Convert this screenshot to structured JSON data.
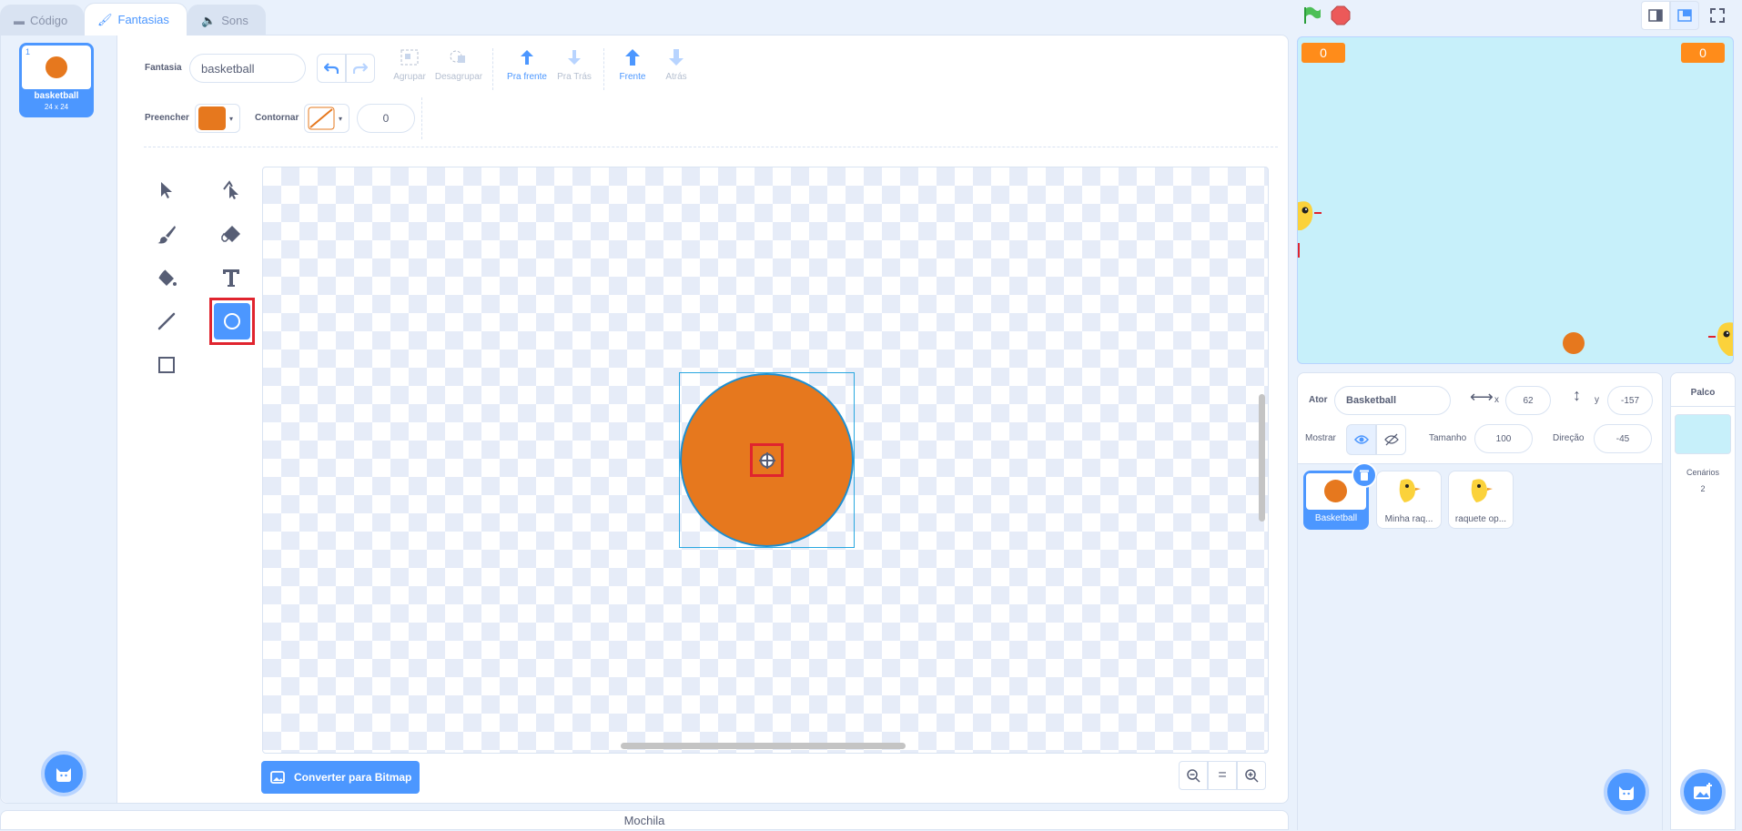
{
  "tabs": {
    "code": "Código",
    "costumes": "Fantasias",
    "sounds": "Sons"
  },
  "costume_list": [
    {
      "number": "1",
      "name": "basketball",
      "size": "24 x 24"
    }
  ],
  "toolbar": {
    "costume_label": "Fantasia",
    "costume_name": "basketball",
    "group": "Agrupar",
    "ungroup": "Desagrupar",
    "forward": "Pra frente",
    "backward": "Pra Trás",
    "front": "Frente",
    "back": "Atrás",
    "fill_label": "Preencher",
    "outline_label": "Contornar",
    "outline_width": "0",
    "fill_color": "#e6781e"
  },
  "tools": {
    "active": "circle-tool"
  },
  "bottom": {
    "convert": "Converter para Bitmap",
    "zoom_reset": "="
  },
  "backpack": "Mochila",
  "stage": {
    "monitor_left": "0",
    "monitor_right": "0",
    "background": "#c7f0fa"
  },
  "sprite_info": {
    "sprite_label": "Ator",
    "sprite_name": "Basketball",
    "x_label": "x",
    "x_value": "62",
    "y_label": "y",
    "y_value": "-157",
    "show_label": "Mostrar",
    "size_label": "Tamanho",
    "size_value": "100",
    "direction_label": "Direção",
    "direction_value": "-45"
  },
  "sprites": [
    {
      "name": "Basketball",
      "selected": true
    },
    {
      "name": "Minha raq..."
    },
    {
      "name": "raquete op..."
    }
  ],
  "stage_pane": {
    "title": "Palco",
    "backdrops_label": "Cenários",
    "backdrops_count": "2"
  }
}
